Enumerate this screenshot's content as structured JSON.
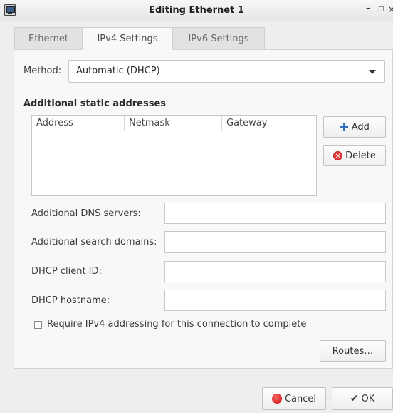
{
  "window": {
    "title": "Editing Ethernet 1",
    "icon": "network-connection-icon"
  },
  "tabs": [
    {
      "label": "Ethernet"
    },
    {
      "label": "IPv4 Settings"
    },
    {
      "label": "IPv6 Settings"
    }
  ],
  "method": {
    "label": "Method:",
    "value": "Automatic (DHCP)"
  },
  "addresses": {
    "title": "Additional static addresses",
    "columns": [
      "Address",
      "Netmask",
      "Gateway"
    ],
    "add_label": "Add",
    "delete_label": "Delete"
  },
  "fields": [
    {
      "label": "Additional DNS servers:",
      "value": ""
    },
    {
      "label": "Additional search domains:",
      "value": ""
    },
    {
      "label": "DHCP client ID:",
      "value": ""
    },
    {
      "label": "DHCP hostname:",
      "value": ""
    }
  ],
  "require_ipv4": {
    "label": "Require IPv4 addressing for this connection to complete",
    "checked": false
  },
  "routes_label": "Routes…",
  "footer": {
    "cancel_label": "Cancel",
    "ok_label": "OK"
  },
  "colors": {
    "accent": "#2d6fc4",
    "danger": "#e23b3b"
  }
}
